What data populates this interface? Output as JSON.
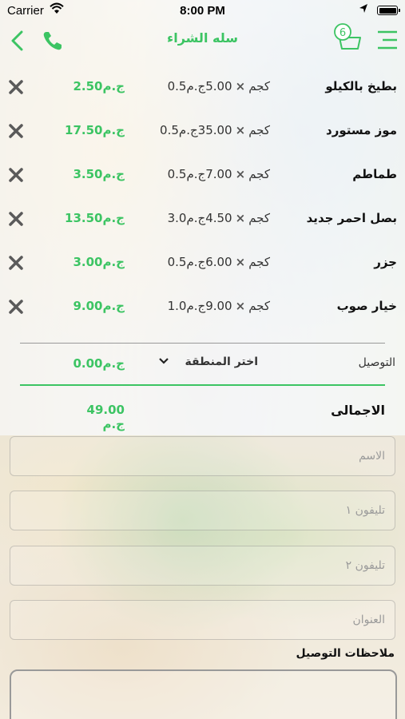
{
  "status_bar": {
    "carrier": "Carrier",
    "time": "8:00 PM"
  },
  "nav": {
    "title": "سله الشراء",
    "cart_count": "6",
    "accent_color": "#3cc463"
  },
  "items": [
    {
      "name": "بطيخ بالكيلو",
      "quantity": "0.5كجم",
      "unit_price": "5.00ج.م",
      "total": "2.50ج.م"
    },
    {
      "name": "موز مستورد",
      "quantity": "0.5كجم",
      "unit_price": "35.00ج.م",
      "total": "17.50ج.م"
    },
    {
      "name": "طماطم",
      "quantity": "0.5كجم",
      "unit_price": "7.00ج.م",
      "total": "3.50ج.م"
    },
    {
      "name": "بصل احمر جديد",
      "quantity": "3.0كجم",
      "unit_price": "4.50ج.م",
      "total": "13.50ج.م"
    },
    {
      "name": "جزر",
      "quantity": "0.5كجم",
      "unit_price": "6.00ج.م",
      "total": "3.00ج.م"
    },
    {
      "name": "خيار صوب",
      "quantity": "1.0كجم",
      "unit_price": "9.00ج.م",
      "total": "9.00ج.م"
    }
  ],
  "times_symbol": "×",
  "delivery": {
    "label": "التوصيل",
    "region_selected": "اختر المنطقة",
    "fee": "0.00ج.م"
  },
  "total": {
    "label": "الاجمالى",
    "value": "49.00 ج.م"
  },
  "form": {
    "name_placeholder": "الاسم",
    "phone1_placeholder": "تليفون ١",
    "phone2_placeholder": "تليفون ٢",
    "address_placeholder": "العنوان",
    "notes_label": "ملاحظات التوصيل"
  }
}
